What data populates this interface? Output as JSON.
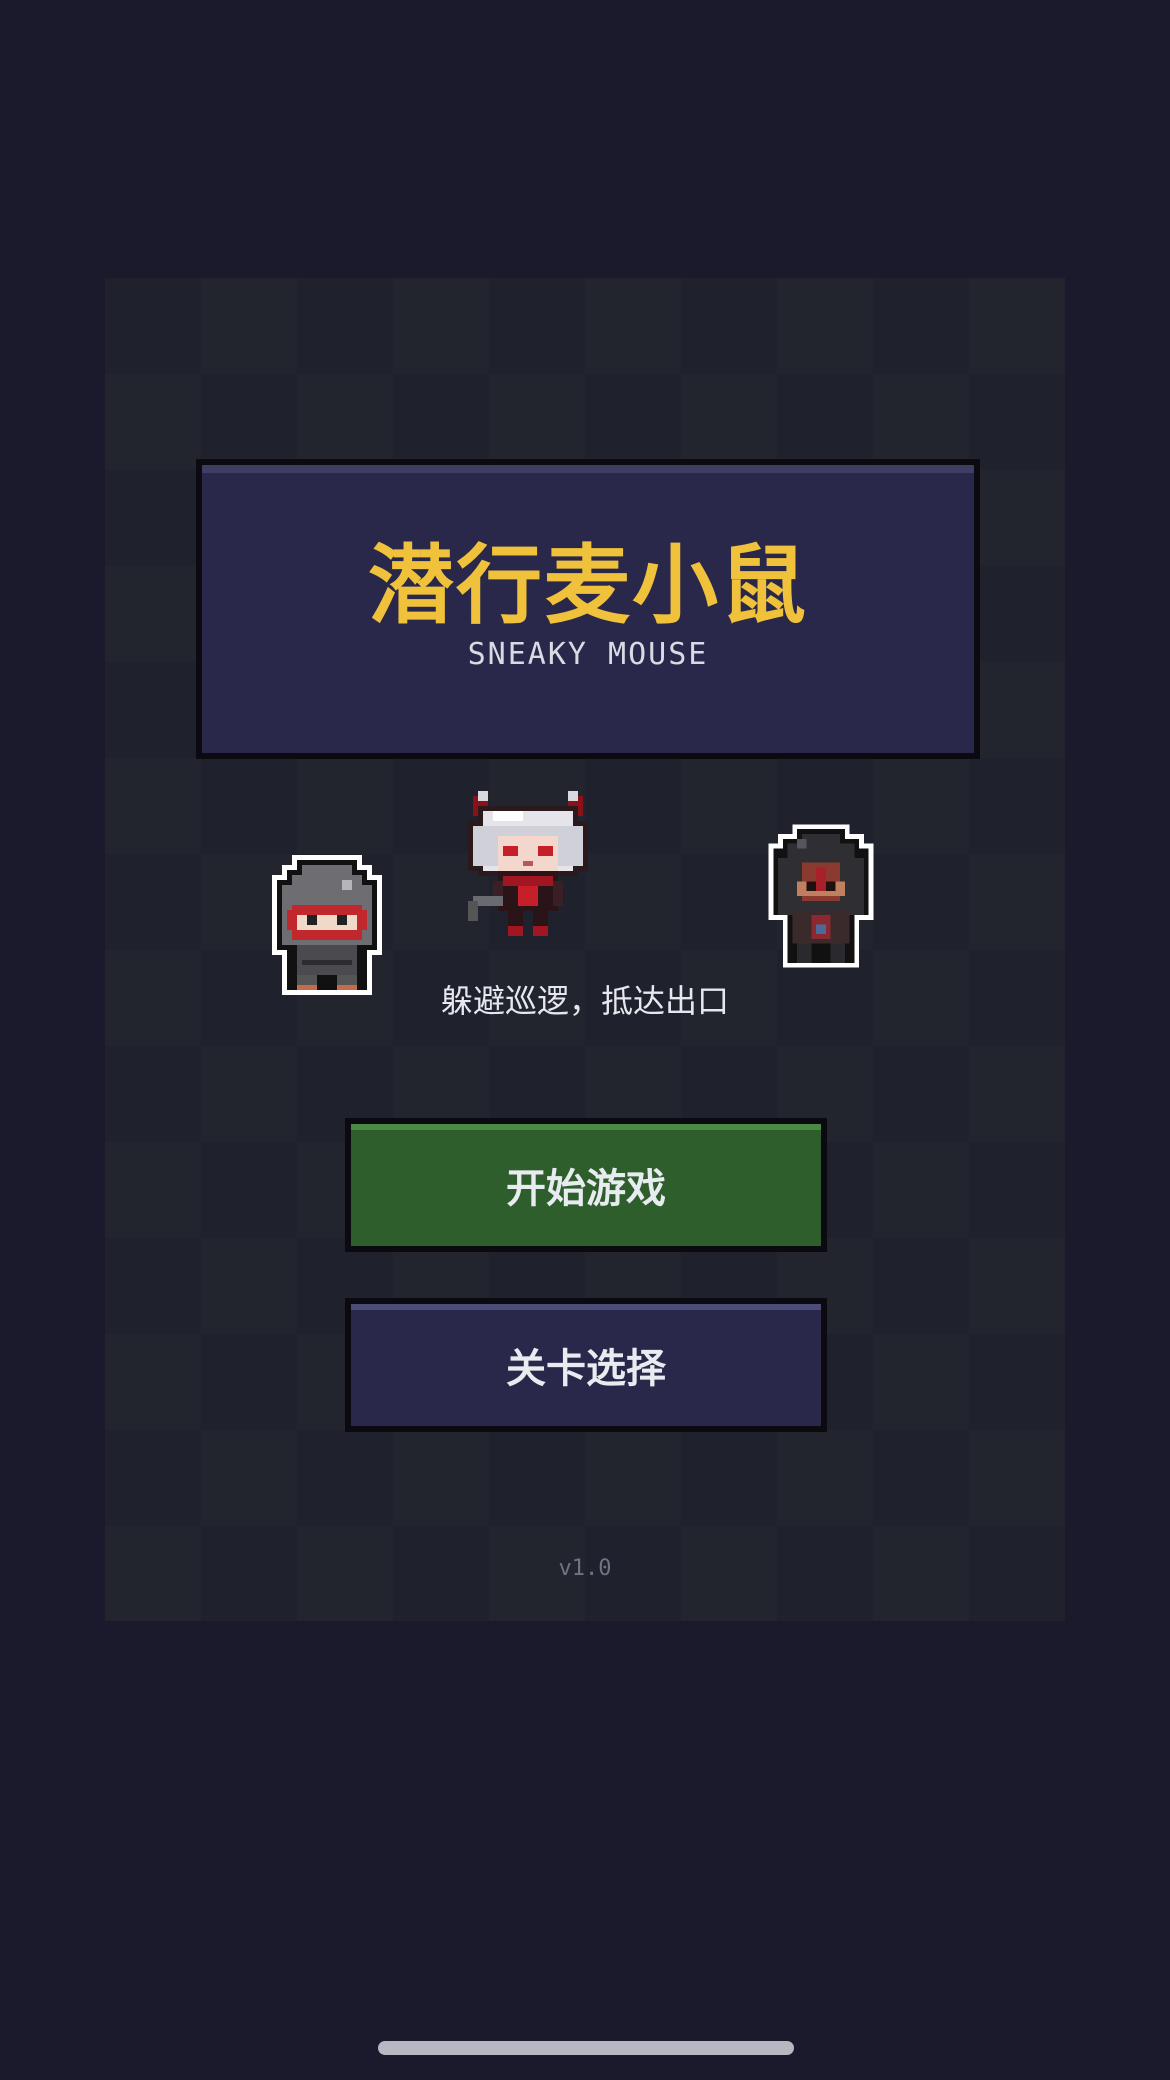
{
  "title": {
    "main": "潜行麦小鼠",
    "sub": "SNEAKY MOUSE"
  },
  "tagline": "躲避巡逻，抵达出口",
  "buttons": {
    "start_label": "开始游戏",
    "level_select_label": "关卡选择"
  },
  "version": "v1.0",
  "characters": [
    {
      "icon": "ninja-mouse-sprite"
    },
    {
      "icon": "white-haired-girl-sprite"
    },
    {
      "icon": "hooded-figure-sprite"
    }
  ],
  "colors": {
    "background": "#1b1a2c",
    "panel": "#1f222c",
    "title_box": "#29284a",
    "title_text": "#f0c13b",
    "start_button": "#2d5e2b",
    "level_button": "#29284a"
  }
}
